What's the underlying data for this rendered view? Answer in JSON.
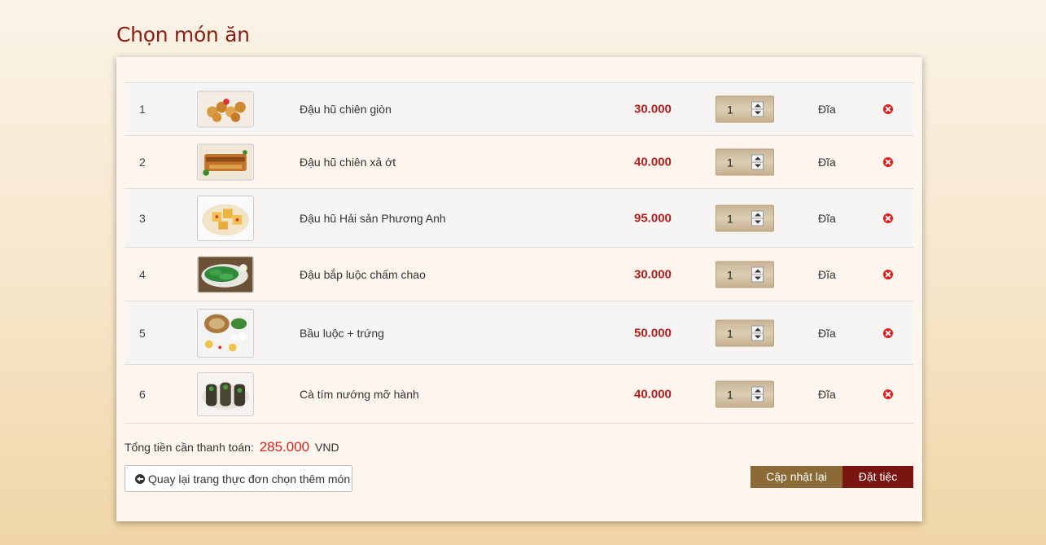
{
  "page": {
    "title": "Chọn món ăn"
  },
  "cart": {
    "items": [
      {
        "index": "1",
        "name": "Đậu hũ chiên giòn",
        "price": "30.000",
        "quantity": "1",
        "unit": "Đĩa",
        "image_icon": "fried-tofu-image"
      },
      {
        "index": "2",
        "name": "Đậu hũ chiên xả ớt",
        "price": "40.000",
        "quantity": "1",
        "unit": "Đĩa",
        "image_icon": "lemongrass-tofu-image"
      },
      {
        "index": "3",
        "name": "Đậu hũ Hải sản Phương Anh",
        "price": "95.000",
        "quantity": "1",
        "unit": "Đĩa",
        "image_icon": "seafood-tofu-image"
      },
      {
        "index": "4",
        "name": "Đậu bắp luộc chấm chao",
        "price": "30.000",
        "quantity": "1",
        "unit": "Đĩa",
        "image_icon": "boiled-okra-image"
      },
      {
        "index": "5",
        "name": "Bầu luộc + trứng",
        "price": "50.000",
        "quantity": "1",
        "unit": "Đĩa",
        "image_icon": "boiled-gourd-egg-image"
      },
      {
        "index": "6",
        "name": "Cà tím nướng mỡ hành",
        "price": "40.000",
        "quantity": "1",
        "unit": "Đĩa",
        "image_icon": "grilled-eggplant-image"
      }
    ]
  },
  "summary": {
    "total_label": "Tổng tiền cần thanh toán:",
    "total_amount": "285.000",
    "currency": "VND"
  },
  "actions": {
    "back_label": "Quay lại trang thực đơn chọn thêm món",
    "update_label": "Cập nhật lại",
    "order_label": "Đặt tiệc"
  },
  "colors": {
    "title": "#8a1e12",
    "price": "#b51f1f",
    "total": "#e0201a",
    "update_button": "#8b6a35",
    "order_button": "#7a1410",
    "remove_icon": "#e01c1c"
  }
}
